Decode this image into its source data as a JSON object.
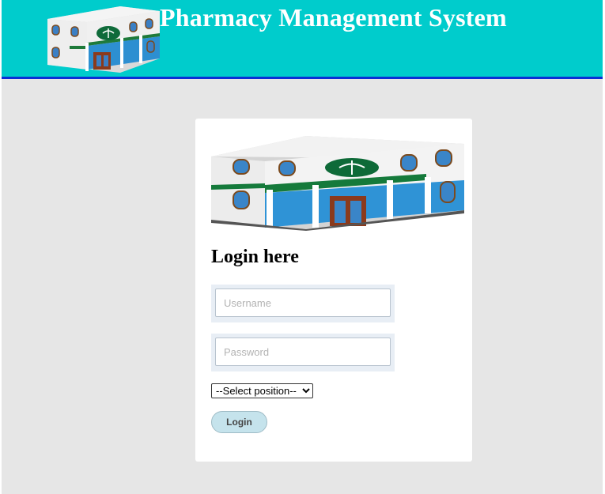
{
  "header": {
    "title": "Pharmacy Management System"
  },
  "login": {
    "heading": "Login here",
    "username_placeholder": "Username",
    "password_placeholder": "Password",
    "position_selected": "--Select position--",
    "button_label": "Login"
  },
  "colors": {
    "header_bg": "#00cccc",
    "header_border": "#0a2fd6",
    "page_bg": "#e6e6e6",
    "button_bg": "#c5e3ec"
  }
}
